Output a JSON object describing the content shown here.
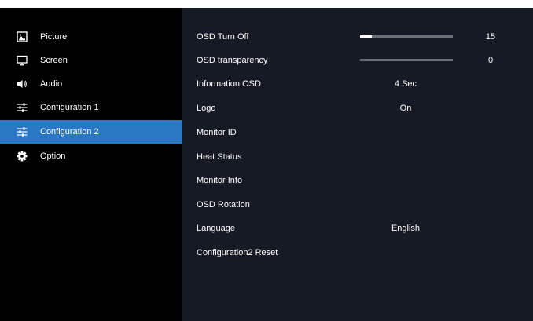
{
  "sidebar": {
    "items": [
      {
        "label": "Picture",
        "icon": "picture-icon"
      },
      {
        "label": "Screen",
        "icon": "monitor-icon"
      },
      {
        "label": "Audio",
        "icon": "speaker-icon"
      },
      {
        "label": "Configuration 1",
        "icon": "sliders-icon"
      },
      {
        "label": "Configuration 2",
        "icon": "sliders-icon",
        "selected": true
      },
      {
        "label": "Option",
        "icon": "gear-icon"
      }
    ]
  },
  "main": {
    "rows": [
      {
        "label": "OSD Turn Off",
        "slider_value": 15,
        "slider_max": 120,
        "display": "15"
      },
      {
        "label": "OSD transparency",
        "slider_value": 0,
        "slider_max": 10,
        "display": "0"
      },
      {
        "label": "Information OSD",
        "value": "4 Sec"
      },
      {
        "label": "Logo",
        "value": "On"
      },
      {
        "label": "Monitor ID"
      },
      {
        "label": "Heat Status"
      },
      {
        "label": "Monitor Info"
      },
      {
        "label": "OSD Rotation"
      },
      {
        "label": "Language",
        "value": "English"
      },
      {
        "label": "Configuration2 Reset"
      }
    ]
  },
  "colors": {
    "selected": "#2a78c3",
    "panel": "#151a25",
    "sidebar": "#000000",
    "slider_track": "#6b6f78"
  }
}
